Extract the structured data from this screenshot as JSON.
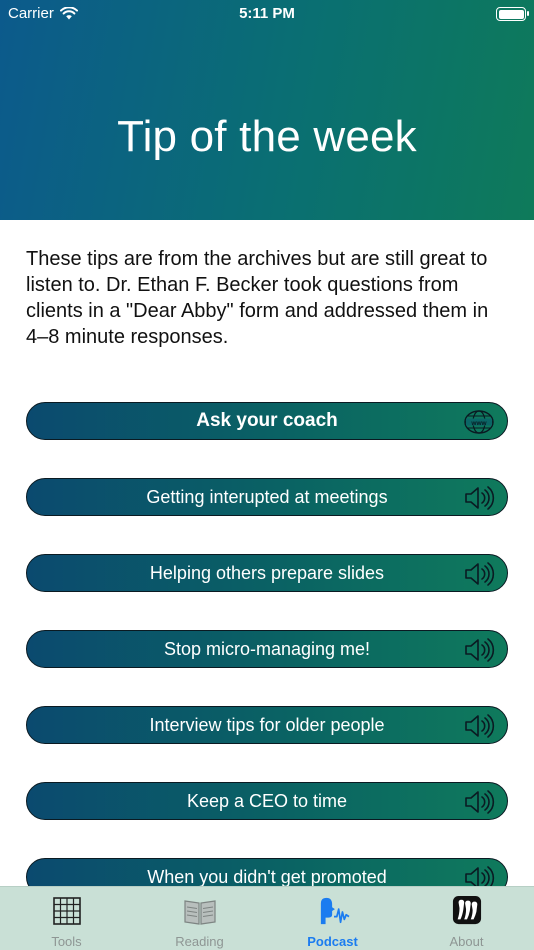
{
  "status": {
    "carrier": "Carrier",
    "time": "5:11 PM"
  },
  "header": {
    "title": "Tip of the week"
  },
  "intro": {
    "text": "These tips are from the archives but are still great to listen to. Dr. Ethan F. Becker took questions from clients in a \"Dear Abby\" form and addressed them in 4–8 minute responses."
  },
  "tips": [
    {
      "label": "Ask your coach",
      "icon": "www-globe-icon"
    },
    {
      "label": "Getting interupted at meetings",
      "icon": "speaker-icon"
    },
    {
      "label": "Helping others prepare slides",
      "icon": "speaker-icon"
    },
    {
      "label": "Stop micro-managing me!",
      "icon": "speaker-icon"
    },
    {
      "label": "Interview tips for older people",
      "icon": "speaker-icon"
    },
    {
      "label": "Keep a CEO to time",
      "icon": "speaker-icon"
    },
    {
      "label": "When you didn't get promoted",
      "icon": "speaker-icon"
    }
  ],
  "tabbar": {
    "active_color": "#1b7cf0",
    "items": [
      {
        "label": "Tools",
        "icon": "grid-icon"
      },
      {
        "label": "Reading",
        "icon": "book-icon"
      },
      {
        "label": "Podcast",
        "icon": "podcast-icon"
      },
      {
        "label": "About",
        "icon": "about-icon"
      }
    ]
  }
}
